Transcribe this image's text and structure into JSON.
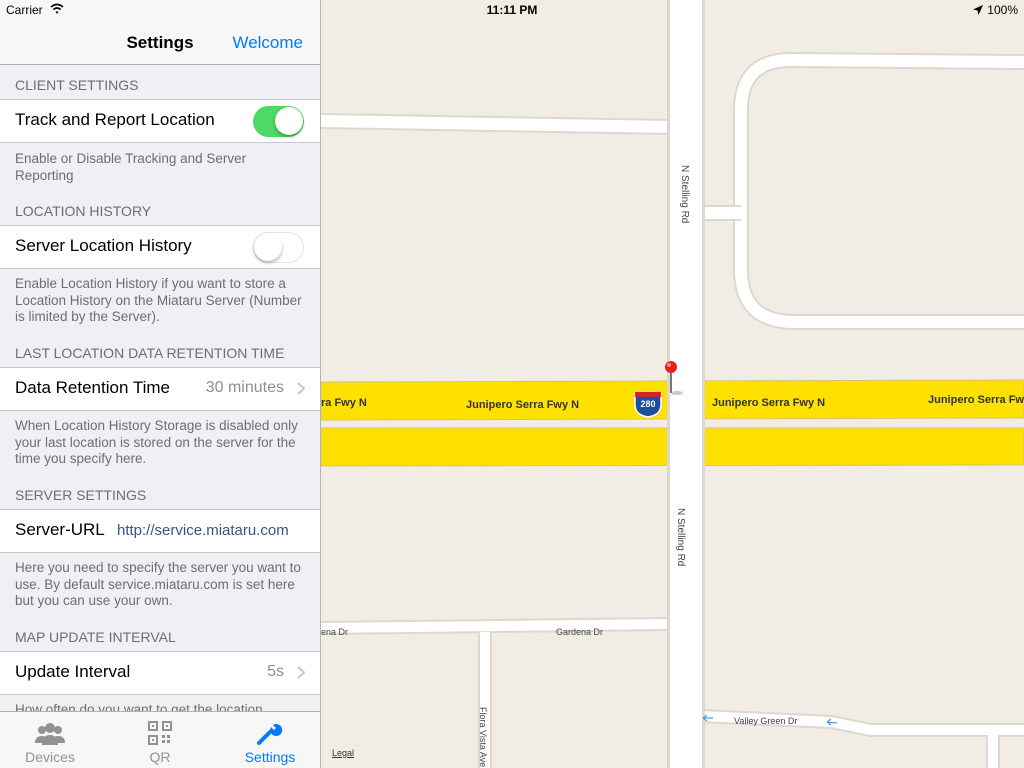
{
  "status_bar": {
    "carrier": "Carrier",
    "time": "11:11 PM",
    "battery": "100%"
  },
  "navbar": {
    "title": "Settings",
    "right_button": "Welcome"
  },
  "sections": {
    "client": {
      "header": "CLIENT SETTINGS",
      "track_label": "Track and Report Location",
      "track_enabled": true,
      "footer": "Enable or Disable Tracking and Server Reporting"
    },
    "history": {
      "header": "LOCATION HISTORY",
      "label": "Server Location History",
      "enabled": false,
      "footer": "Enable Location History if you want to store a Location History on the Miataru Server (Number is limited by the Server)."
    },
    "retention": {
      "header": "LAST LOCATION DATA RETENTION TIME",
      "label": "Data Retention Time",
      "value": "30 minutes",
      "footer": "When Location History Storage is disabled only your last location is stored on the server for the time you specify here."
    },
    "server": {
      "header": "SERVER SETTINGS",
      "label": "Server-URL",
      "value": "http://service.miataru.com",
      "footer": "Here you need to specify the server you want to use. By default service.miataru.com is set here but you can use your own."
    },
    "interval": {
      "header": "MAP UPDATE INTERVAL",
      "label": "Update Interval",
      "value": "5s",
      "footer": "How often do you want to get the location"
    }
  },
  "tabs": [
    {
      "label": "Devices",
      "icon": "people-icon",
      "active": false
    },
    {
      "label": "QR",
      "icon": "qr-code-icon",
      "active": false
    },
    {
      "label": "Settings",
      "icon": "wrench-icon",
      "active": true
    }
  ],
  "map": {
    "streets": {
      "stelling_upper": "N Stelling Rd",
      "stelling_lower": "N Stelling Rd",
      "freeway_1": "ra Fwy N",
      "freeway_2": "Junipero Serra Fwy N",
      "freeway_3": "Junipero Serra Fwy N",
      "freeway_4": "Junipero Serra Fwy",
      "gardena": "Gardena Dr",
      "gardena_partial": "ena Dr",
      "valley_green": "Valley Green Dr",
      "flora_vista": "Flora Vista Ave"
    },
    "highway_shield": "280",
    "legal": "Legal",
    "colors": {
      "freeway": "#ffe100",
      "land": "#f1ede5",
      "road": "#ffffff",
      "pin": "#e8201e"
    }
  }
}
